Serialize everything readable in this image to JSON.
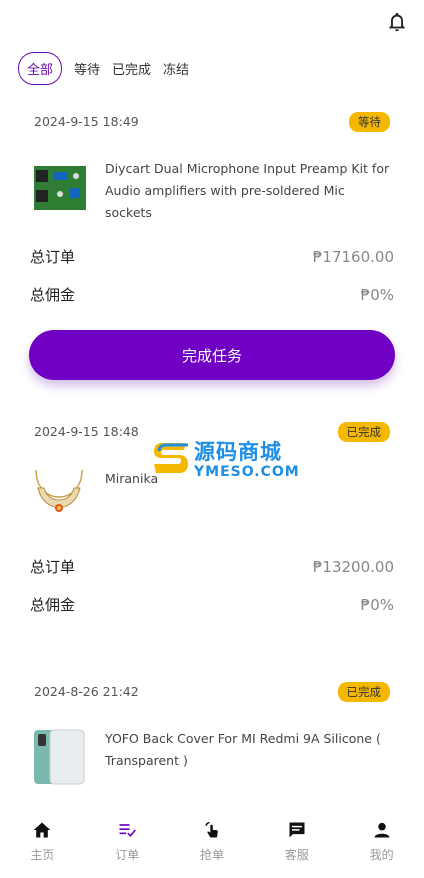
{
  "header": {
    "bell_icon": "bell-icon"
  },
  "tabs": [
    {
      "label": "全部",
      "active": true
    },
    {
      "label": "等待"
    },
    {
      "label": "已完成"
    },
    {
      "label": "冻结"
    }
  ],
  "orders": [
    {
      "date": "2024-9-15 18:49",
      "status": "等待",
      "product": "Diycart Dual Microphone Input Preamp Kit for Audio amplifiers with pre-soldered Mic sockets",
      "total_label": "总订单",
      "total_value": "₱17160.00",
      "commission_label": "总佣金",
      "commission_value": "₱0%",
      "action": "完成任务"
    },
    {
      "date": "2024-9-15 18:48",
      "status": "已完成",
      "product": "Miranika",
      "total_label": "总订单",
      "total_value": "₱13200.00",
      "commission_label": "总佣金",
      "commission_value": "₱0%"
    },
    {
      "date": "2024-8-26 21:42",
      "status": "已完成",
      "product": "YOFO Back Cover For MI Redmi 9A Silicone ( Transparent )"
    }
  ],
  "watermark": {
    "cn": "源码商城",
    "en": "YMESO.COM"
  },
  "nav": [
    {
      "label": "主页",
      "icon": "home-icon"
    },
    {
      "label": "订单",
      "icon": "orders-icon",
      "active": true
    },
    {
      "label": "抢单",
      "icon": "grab-order-icon"
    },
    {
      "label": "客服",
      "icon": "chat-icon"
    },
    {
      "label": "我的",
      "icon": "user-icon"
    }
  ],
  "colors": {
    "accent": "#6f00c4",
    "badge": "#f5b800"
  }
}
